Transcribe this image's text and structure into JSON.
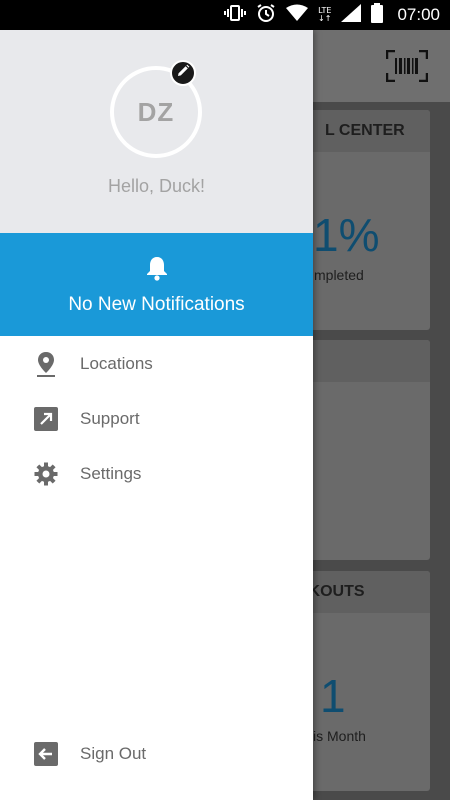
{
  "status_bar": {
    "network_label": "LTE",
    "time": "07:00"
  },
  "background_app": {
    "card1": {
      "header": "L CENTER",
      "value": "1%",
      "caption": "mpleted"
    },
    "card3": {
      "header": "RKOUTS",
      "value": "1",
      "caption": "is Month"
    },
    "accent_color": "#1a99d8"
  },
  "drawer": {
    "avatar_initials": "DZ",
    "greeting": "Hello, Duck!",
    "notification_text": "No New Notifications",
    "menu": [
      {
        "label": "Locations",
        "icon": "location-pin-icon"
      },
      {
        "label": "Support",
        "icon": "external-link-icon"
      },
      {
        "label": "Settings",
        "icon": "gear-icon"
      }
    ],
    "sign_out_label": "Sign Out",
    "colors": {
      "header_bg": "#e8e9ec",
      "notification_bg": "#1a99d8",
      "menu_text": "#6a6a6a"
    }
  }
}
